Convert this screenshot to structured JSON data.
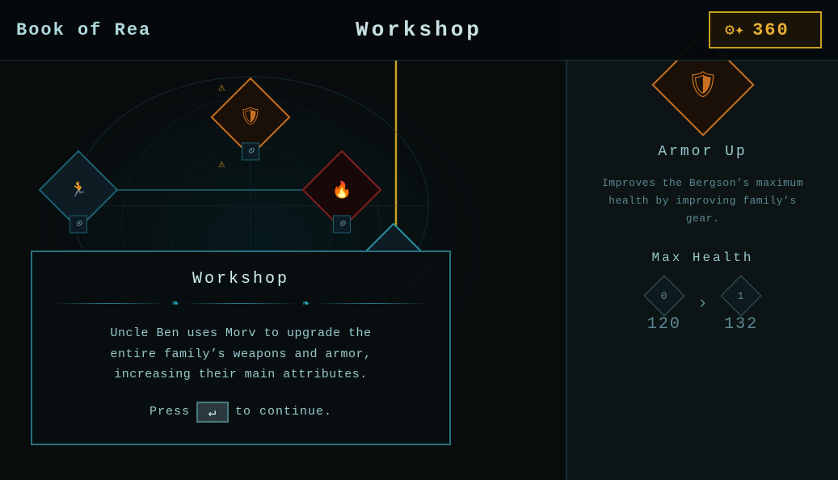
{
  "header": {
    "title_left": "Book of Rea",
    "title_center": "Workshop",
    "currency": {
      "amount": "360",
      "icon": "⚙"
    }
  },
  "dialog": {
    "title": "Workshop",
    "body_line1": "Uncle Ben uses Morv to upgrade the",
    "body_line2": "entire family’s weapons and armor,",
    "body_line3": "increasing their main attributes.",
    "continue_prefix": "Press",
    "continue_key": "↵",
    "continue_suffix": "to continue."
  },
  "right_panel": {
    "ability_name": "Armor Up",
    "ability_description_line1": "Improves the Bergson’s maximum",
    "ability_description_line2": "health by improving family’s",
    "ability_description_line3": "gear.",
    "stat_label": "Max Health",
    "stat_from_level": "0",
    "stat_from_value": "120",
    "stat_to_level": "1",
    "stat_to_value": "132"
  },
  "skill_nodes": [
    {
      "id": "armor",
      "level": "0",
      "highlight": "orange"
    },
    {
      "id": "runner",
      "level": "0",
      "highlight": "teal"
    },
    {
      "id": "fire",
      "level": "0",
      "highlight": "red"
    },
    {
      "id": "workshop",
      "level": "0",
      "highlight": "teal"
    }
  ]
}
